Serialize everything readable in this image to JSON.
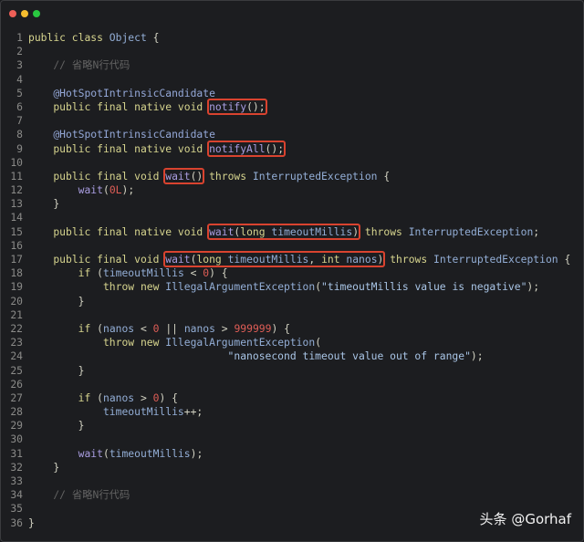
{
  "window": {
    "controls": [
      {
        "name": "close",
        "color": "#ee5f57"
      },
      {
        "name": "minimize",
        "color": "#f5bd2f"
      },
      {
        "name": "maximize",
        "color": "#29c840"
      }
    ]
  },
  "watermark": "头条 @Gorhaf",
  "code": [
    [
      [
        "kw",
        "public class "
      ],
      [
        "ty",
        "Object"
      ],
      [
        "pl",
        " {"
      ]
    ],
    [],
    [
      [
        "pl",
        "    "
      ],
      [
        "cm",
        "// 省略N行代码"
      ]
    ],
    [],
    [
      [
        "pl",
        "    "
      ],
      [
        "an",
        "@HotSpotIntrinsicCandidate"
      ]
    ],
    [
      [
        "pl",
        "    "
      ],
      [
        "kw",
        "public final native void "
      ],
      {
        "box": [
          [
            "nm",
            "notify"
          ],
          [
            "pl",
            "();"
          ]
        ]
      }
    ],
    [],
    [
      [
        "pl",
        "    "
      ],
      [
        "an",
        "@HotSpotIntrinsicCandidate"
      ]
    ],
    [
      [
        "pl",
        "    "
      ],
      [
        "kw",
        "public final native void "
      ],
      {
        "box": [
          [
            "nm",
            "notifyAll"
          ],
          [
            "pl",
            "();"
          ]
        ]
      }
    ],
    [],
    [
      [
        "pl",
        "    "
      ],
      [
        "kw",
        "public final void "
      ],
      {
        "box": [
          [
            "nm",
            "wait"
          ],
          [
            "pl",
            "()"
          ]
        ]
      },
      [
        "kw",
        " throws "
      ],
      [
        "ty",
        "InterruptedException"
      ],
      [
        "pl",
        " {"
      ]
    ],
    [
      [
        "pl",
        "        "
      ],
      [
        "nm",
        "wait"
      ],
      [
        "pl",
        "("
      ],
      [
        "nu",
        "0L"
      ],
      [
        "pl",
        ");"
      ]
    ],
    [
      [
        "pl",
        "    }"
      ]
    ],
    [],
    [
      [
        "pl",
        "    "
      ],
      [
        "kw",
        "public final native void "
      ],
      {
        "box": [
          [
            "nm",
            "wait"
          ],
          [
            "pl",
            "("
          ],
          [
            "kw",
            "long "
          ],
          [
            "ty",
            "timeoutMillis"
          ],
          [
            "pl",
            ")"
          ]
        ]
      },
      [
        "kw",
        " throws "
      ],
      [
        "ty",
        "InterruptedException"
      ],
      [
        "pl",
        ";"
      ]
    ],
    [],
    [
      [
        "pl",
        "    "
      ],
      [
        "kw",
        "public final void "
      ],
      {
        "box": [
          [
            "nm",
            "wait"
          ],
          [
            "pl",
            "("
          ],
          [
            "kw",
            "long "
          ],
          [
            "ty",
            "timeoutMillis"
          ],
          [
            "pl",
            ", "
          ],
          [
            "kw",
            "int "
          ],
          [
            "ty",
            "nanos"
          ],
          [
            "pl",
            ")"
          ]
        ]
      },
      [
        "kw",
        " throws "
      ],
      [
        "ty",
        "InterruptedException"
      ],
      [
        "pl",
        " {"
      ]
    ],
    [
      [
        "pl",
        "        "
      ],
      [
        "kw",
        "if "
      ],
      [
        "pl",
        "("
      ],
      [
        "ty",
        "timeoutMillis"
      ],
      [
        "pl",
        " < "
      ],
      [
        "nu",
        "0"
      ],
      [
        "pl",
        ") {"
      ]
    ],
    [
      [
        "pl",
        "            "
      ],
      [
        "kw",
        "throw new "
      ],
      [
        "ty",
        "IllegalArgumentException"
      ],
      [
        "pl",
        "("
      ],
      [
        "st",
        "\"timeoutMillis value is negative\""
      ],
      [
        "pl",
        ");"
      ]
    ],
    [
      [
        "pl",
        "        }"
      ]
    ],
    [],
    [
      [
        "pl",
        "        "
      ],
      [
        "kw",
        "if "
      ],
      [
        "pl",
        "("
      ],
      [
        "ty",
        "nanos"
      ],
      [
        "pl",
        " < "
      ],
      [
        "nu",
        "0"
      ],
      [
        "pl",
        " || "
      ],
      [
        "ty",
        "nanos"
      ],
      [
        "pl",
        " > "
      ],
      [
        "nu",
        "999999"
      ],
      [
        "pl",
        ") {"
      ]
    ],
    [
      [
        "pl",
        "            "
      ],
      [
        "kw",
        "throw new "
      ],
      [
        "ty",
        "IllegalArgumentException"
      ],
      [
        "pl",
        "("
      ]
    ],
    [
      [
        "pl",
        "                                "
      ],
      [
        "st",
        "\"nanosecond timeout value out of range\""
      ],
      [
        "pl",
        ");"
      ]
    ],
    [
      [
        "pl",
        "        }"
      ]
    ],
    [],
    [
      [
        "pl",
        "        "
      ],
      [
        "kw",
        "if "
      ],
      [
        "pl",
        "("
      ],
      [
        "ty",
        "nanos"
      ],
      [
        "pl",
        " > "
      ],
      [
        "nu",
        "0"
      ],
      [
        "pl",
        ") {"
      ]
    ],
    [
      [
        "pl",
        "            "
      ],
      [
        "ty",
        "timeoutMillis"
      ],
      [
        "pl",
        "++;"
      ]
    ],
    [
      [
        "pl",
        "        }"
      ]
    ],
    [],
    [
      [
        "pl",
        "        "
      ],
      [
        "nm",
        "wait"
      ],
      [
        "pl",
        "("
      ],
      [
        "ty",
        "timeoutMillis"
      ],
      [
        "pl",
        ");"
      ]
    ],
    [
      [
        "pl",
        "    }"
      ]
    ],
    [],
    [
      [
        "pl",
        "    "
      ],
      [
        "cm",
        "// 省略N行代码"
      ]
    ],
    [],
    [
      [
        "pl",
        "}"
      ]
    ]
  ]
}
